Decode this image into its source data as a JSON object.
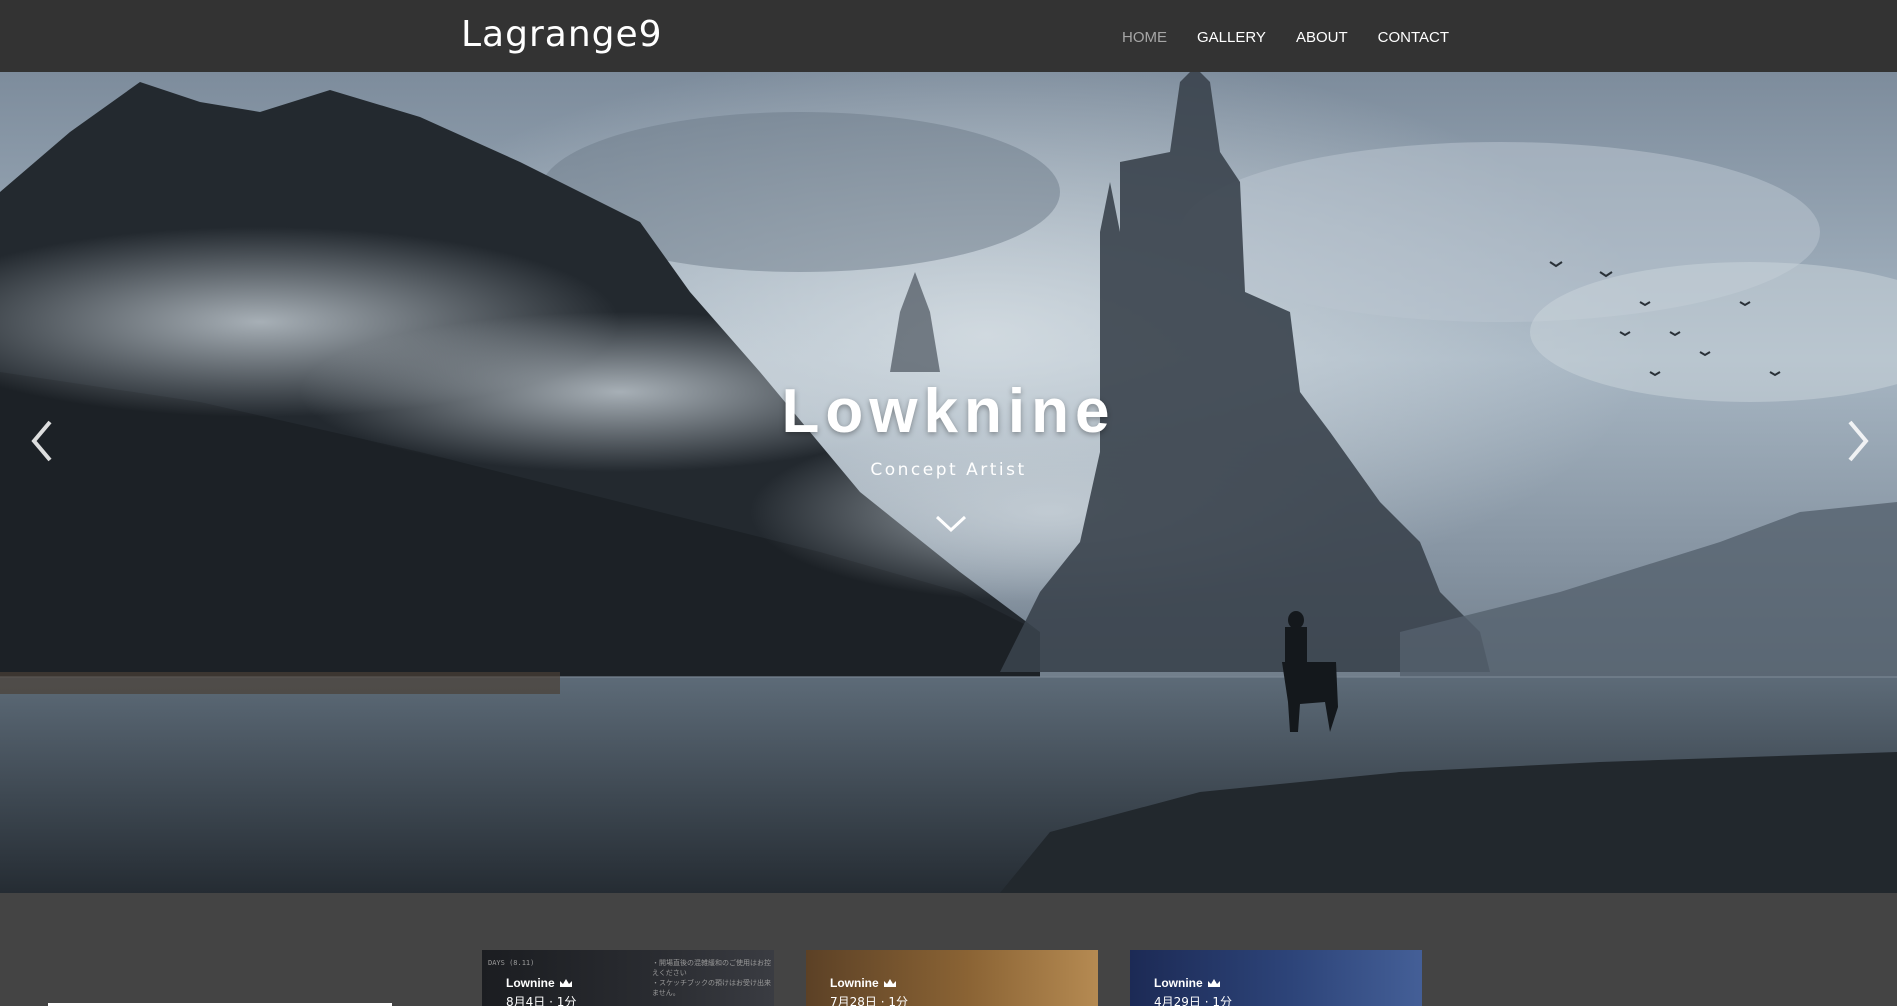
{
  "header": {
    "logo": "Lagrange9",
    "nav": [
      "HOME",
      "GALLERY",
      "ABOUT",
      "CONTACT"
    ],
    "active_nav": "HOME"
  },
  "hero": {
    "title": "Lowknine",
    "subtitle": "Concept Artist",
    "prev_icon": "chevron-left-icon",
    "next_icon": "chevron-right-icon",
    "scroll_icon": "chevron-down-icon"
  },
  "gallery": [
    {
      "author": "Lownine",
      "date": "8月4日 · 1分",
      "badge_icon": "crown-icon",
      "deco_left": "DAYS (8.11)",
      "deco_right": "・開場直後の混雑緩和のご使用はお控えください\n・スケッチブックの預けはお受け出来ません。"
    },
    {
      "author": "Lownine",
      "date": "7月28日 · 1分",
      "badge_icon": "crown-icon"
    },
    {
      "author": "Lownine",
      "date": "4月29日 · 1分",
      "badge_icon": "crown-icon"
    }
  ],
  "colors": {
    "header_bg": "#333333",
    "page_bg": "#444444",
    "nav_active": "#a6a6a6",
    "text": "#ffffff"
  }
}
